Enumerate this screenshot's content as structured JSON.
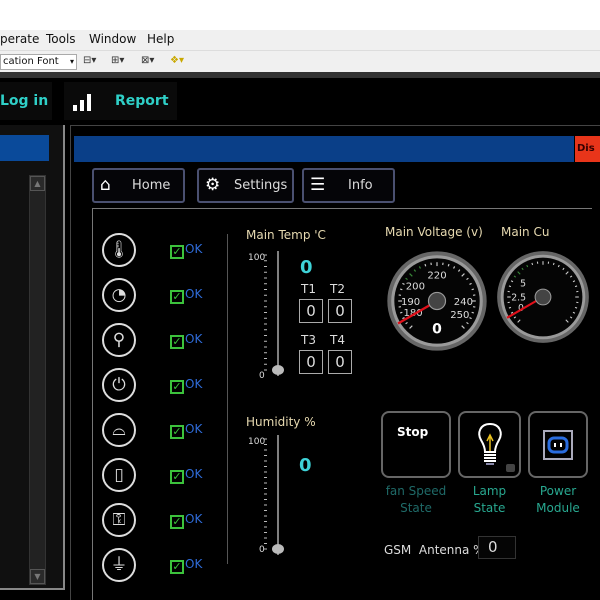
{
  "menu": {
    "items": [
      "perate",
      "Tools",
      "Window",
      "Help"
    ]
  },
  "toolbar": {
    "font_select": "cation Font",
    "icons": [
      "align-icon",
      "distribute-icon",
      "resize-icon",
      "reorder-icon"
    ]
  },
  "nav": {
    "login_label": "Log in",
    "report_label": "Report"
  },
  "header": {
    "disconnect_label": "Dis"
  },
  "tabs": [
    {
      "label": "Home",
      "icon": "home-icon"
    },
    {
      "label": "Settings",
      "icon": "gear-icon"
    },
    {
      "label": "Info",
      "icon": "list-icon"
    }
  ],
  "status_rows": [
    {
      "icon": "thermometer-icon",
      "status": "OK"
    },
    {
      "icon": "humidity-icon",
      "status": "OK"
    },
    {
      "icon": "water-tap-icon",
      "status": "OK"
    },
    {
      "icon": "power-plug-icon",
      "status": "OK"
    },
    {
      "icon": "smoke-detector-icon",
      "status": "OK"
    },
    {
      "icon": "vibration-icon",
      "status": "OK"
    },
    {
      "icon": "door-lock-icon",
      "status": "OK"
    },
    {
      "icon": "ground-icon",
      "status": "OK"
    }
  ],
  "temp": {
    "label": "Main Temp 'C",
    "max": "100",
    "min": "0",
    "value": "0",
    "level": 0,
    "sensors": [
      {
        "name": "T1",
        "value": "0"
      },
      {
        "name": "T2",
        "value": "0"
      },
      {
        "name": "T3",
        "value": "0"
      },
      {
        "name": "T4",
        "value": "0"
      }
    ]
  },
  "humidity": {
    "label": "Humidity %",
    "max": "100",
    "min": "0",
    "value": "0",
    "level": 0
  },
  "voltage": {
    "label": "Main Voltage (v)",
    "ticks": [
      "180",
      "190",
      "200",
      "220",
      "240",
      "250"
    ],
    "value": "0"
  },
  "current": {
    "label": "Main Cu",
    "ticks": [
      "0",
      "2.5",
      "5"
    ]
  },
  "buttons": {
    "fan": {
      "label": "Stop",
      "caption1": "fan Speed",
      "caption2": "State"
    },
    "lamp": {
      "caption1": "Lamp",
      "caption2": "State"
    },
    "power": {
      "caption1": "Power",
      "caption2": "Module"
    }
  },
  "gsm": {
    "label": "GSM  Antenna %",
    "value": "0"
  },
  "colors": {
    "accent": "#2fd0c8",
    "header_blue": "#0a3f88",
    "disconnect": "#e8351a",
    "ok_green": "#3cc23c",
    "needle": "#e0101a"
  }
}
